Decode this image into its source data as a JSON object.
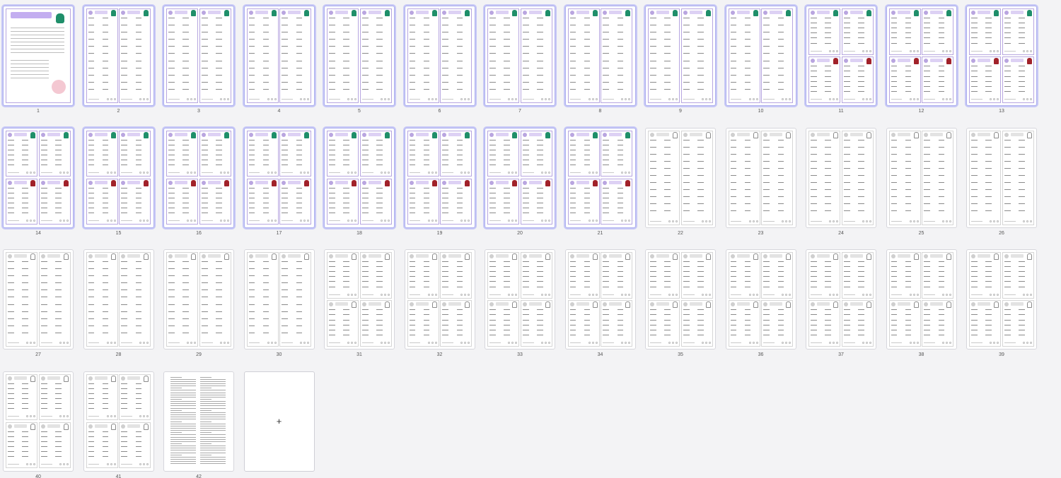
{
  "pages": [
    {
      "number": "1",
      "kind": "cover"
    },
    {
      "number": "2",
      "kind": "purple-2col"
    },
    {
      "number": "3",
      "kind": "purple-2col"
    },
    {
      "number": "4",
      "kind": "purple-2col"
    },
    {
      "number": "5",
      "kind": "purple-2col"
    },
    {
      "number": "6",
      "kind": "purple-2col"
    },
    {
      "number": "7",
      "kind": "purple-2col"
    },
    {
      "number": "8",
      "kind": "purple-2col"
    },
    {
      "number": "9",
      "kind": "purple-2col"
    },
    {
      "number": "10",
      "kind": "purple-2col"
    },
    {
      "number": "11",
      "kind": "purple-4card"
    },
    {
      "number": "12",
      "kind": "purple-4card"
    },
    {
      "number": "13",
      "kind": "purple-4card"
    },
    {
      "number": "14",
      "kind": "purple-4card"
    },
    {
      "number": "15",
      "kind": "purple-4card"
    },
    {
      "number": "16",
      "kind": "purple-4card"
    },
    {
      "number": "17",
      "kind": "purple-4card"
    },
    {
      "number": "18",
      "kind": "purple-4card"
    },
    {
      "number": "19",
      "kind": "purple-4card"
    },
    {
      "number": "20",
      "kind": "purple-4card"
    },
    {
      "number": "21",
      "kind": "purple-4card"
    },
    {
      "number": "22",
      "kind": "gray-2col"
    },
    {
      "number": "23",
      "kind": "gray-2col"
    },
    {
      "number": "24",
      "kind": "gray-2col"
    },
    {
      "number": "25",
      "kind": "gray-2col"
    },
    {
      "number": "26",
      "kind": "gray-2col"
    },
    {
      "number": "27",
      "kind": "gray-2col"
    },
    {
      "number": "28",
      "kind": "gray-2col"
    },
    {
      "number": "29",
      "kind": "gray-2col"
    },
    {
      "number": "30",
      "kind": "gray-2col"
    },
    {
      "number": "31",
      "kind": "gray-4card"
    },
    {
      "number": "32",
      "kind": "gray-4card"
    },
    {
      "number": "33",
      "kind": "gray-4card"
    },
    {
      "number": "34",
      "kind": "gray-4card"
    },
    {
      "number": "35",
      "kind": "gray-4card"
    },
    {
      "number": "36",
      "kind": "gray-4card"
    },
    {
      "number": "37",
      "kind": "gray-4card"
    },
    {
      "number": "38",
      "kind": "gray-4card"
    },
    {
      "number": "39",
      "kind": "gray-4card"
    },
    {
      "number": "40",
      "kind": "gray-4card"
    },
    {
      "number": "41",
      "kind": "gray-4card"
    },
    {
      "number": "42",
      "kind": "answers"
    }
  ],
  "add_page": {
    "label": "+"
  },
  "colors": {
    "accent_purple": "#b7a6e0",
    "selected_border": "#aeb0ee",
    "penguin_green": "#1f8f6a",
    "hat_red": "#a1222a"
  }
}
